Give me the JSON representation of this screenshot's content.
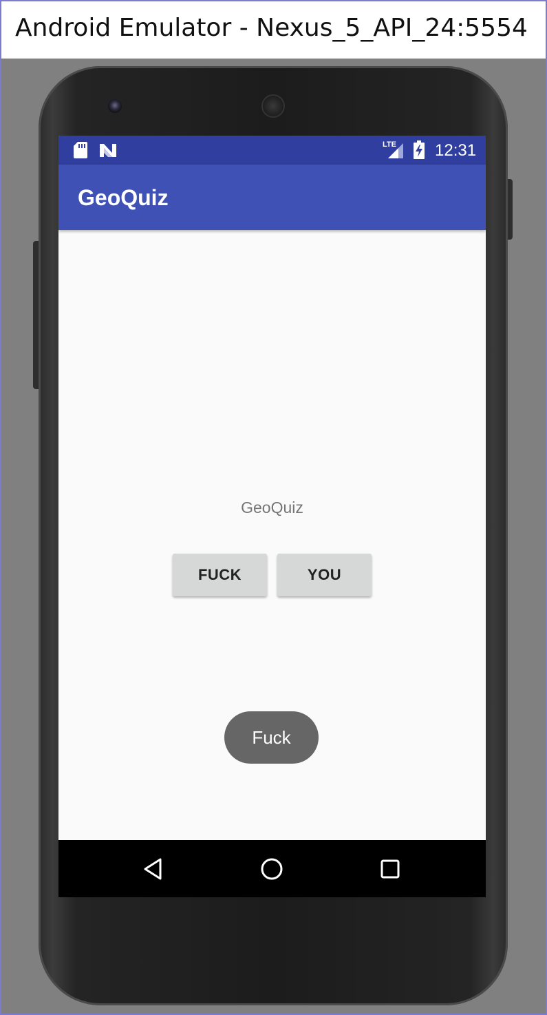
{
  "window": {
    "title": "Android Emulator - Nexus_5_API_24:5554"
  },
  "status_bar": {
    "time": "12:31",
    "network_label": "LTE",
    "icons": [
      "sd-card-icon",
      "n-logo-icon",
      "signal-icon",
      "battery-charging-icon"
    ]
  },
  "app_bar": {
    "title": "GeoQuiz"
  },
  "content": {
    "question_text": "GeoQuiz",
    "true_button_label": "FUCK",
    "false_button_label": "YOU"
  },
  "toast": {
    "message": "Fuck"
  },
  "nav_bar": {
    "icons": [
      "back-icon",
      "home-icon",
      "recents-icon"
    ]
  },
  "colors": {
    "status_bar": "#303f9f",
    "app_bar": "#3f51b5",
    "background": "#fafafa",
    "button": "#d6d7d7",
    "toast": "#666666"
  }
}
